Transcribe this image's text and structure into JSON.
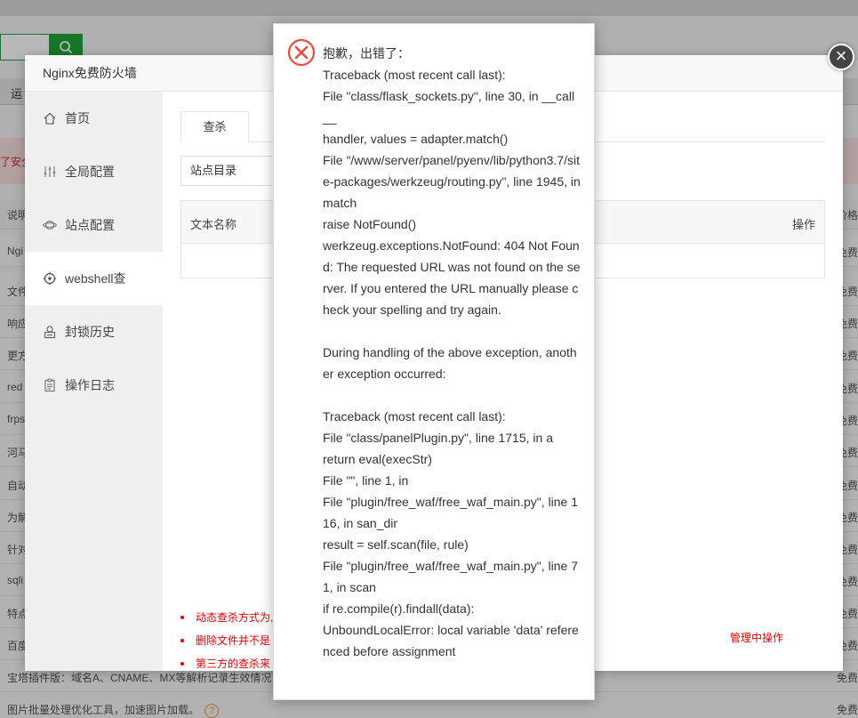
{
  "background": {
    "tab_label": "运",
    "alert_text": "了安全",
    "header_left": "说明",
    "header_right": "价格",
    "rows": [
      {
        "left": "Ngi",
        "right": "免费"
      },
      {
        "left": "文件",
        "right": "免费"
      },
      {
        "left": "响应",
        "right": "免费"
      },
      {
        "left": "更方",
        "right": "免费"
      },
      {
        "left": "red",
        "right": "免费"
      },
      {
        "left": "frps",
        "right": "免费"
      },
      {
        "left": "河马",
        "right": "免费"
      },
      {
        "left": "自动",
        "right": "免费"
      },
      {
        "left": "为解",
        "right": "免费"
      },
      {
        "left": "针对",
        "right": "免费"
      },
      {
        "left": "sqli",
        "right": "免费"
      },
      {
        "left": "特点",
        "right": "免费"
      },
      {
        "left": "百度",
        "right": "免费"
      },
      {
        "left": "宝塔插件版：域名A、CNAME、MX等解析记录生效情况",
        "right": "免费"
      },
      {
        "left": "图片批量处理优化工具，加速图片加载。",
        "right": "免费",
        "help": "?"
      }
    ]
  },
  "window": {
    "title": "Nginx免费防火墙",
    "close_label": "×",
    "sidebar": [
      {
        "label": "首页",
        "icon": "home-icon"
      },
      {
        "label": "全局配置",
        "icon": "sliders-icon"
      },
      {
        "label": "站点配置",
        "icon": "planet-icon"
      },
      {
        "label": "webshell查",
        "icon": "target-icon",
        "active": true
      },
      {
        "label": "封锁历史",
        "icon": "block-icon"
      },
      {
        "label": "操作日志",
        "icon": "clipboard-icon"
      }
    ],
    "tab_label": "查杀",
    "select_value": "站点目录",
    "table": {
      "col_name": "文本名称",
      "col_action": "操作"
    },
    "notes": [
      "动态查杀方式为,",
      "删除文件并不是",
      "第三方的查杀来"
    ],
    "note_tail": "管理中操作"
  },
  "error_dialog": {
    "icon": "error-x-icon",
    "message": "抱歉，出错了：\nTraceback (most recent call last):\nFile \"class/flask_sockets.py\", line 30, in __call__\nhandler, values = adapter.match()\nFile \"/www/server/panel/pyenv/lib/python3.7/site-packages/werkzeug/routing.py\", line 1945, in match\nraise NotFound()\nwerkzeug.exceptions.NotFound: 404 Not Found: The requested URL was not found on the server. If you entered the URL manually please check your spelling and try again.\n\nDuring handling of the above exception, another exception occurred:\n\nTraceback (most recent call last):\nFile \"class/panelPlugin.py\", line 1715, in a\nreturn eval(execStr)\nFile \"\", line 1, in\nFile \"plugin/free_waf/free_waf_main.py\", line 116, in san_dir\nresult = self.scan(file, rule)\nFile \"plugin/free_waf/free_waf_main.py\", line 71, in scan\nif re.compile(r).findall(data):\nUnboundLocalError: local variable 'data' referenced before assignment"
  }
}
